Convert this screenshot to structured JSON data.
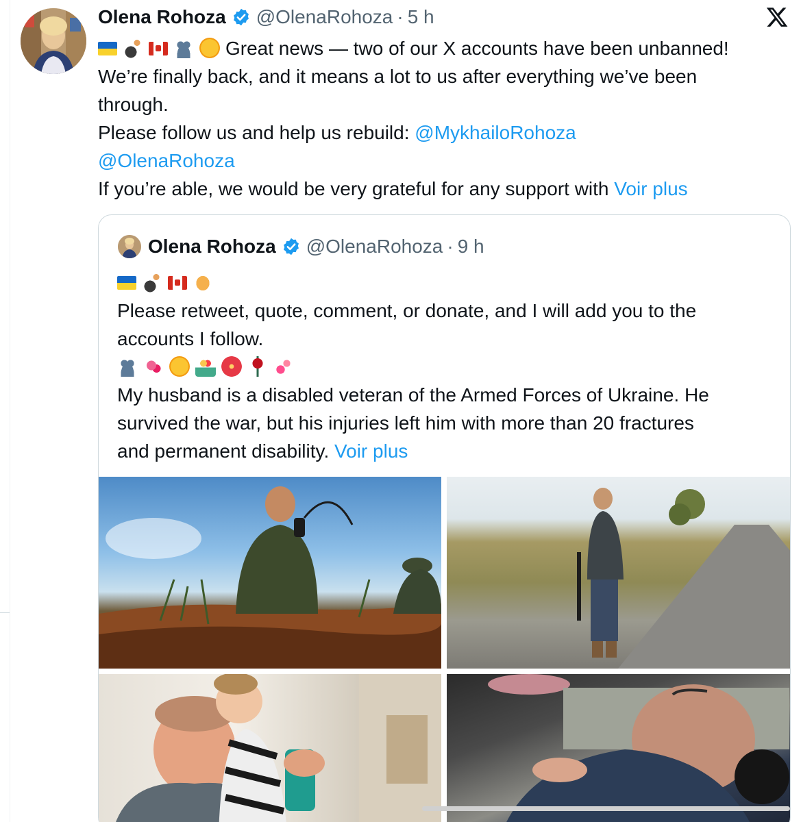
{
  "tweet": {
    "author_name": "Olena Rohoza",
    "handle": "@OlenaRohoza",
    "separator": "·",
    "time": "5 h",
    "line1_text": "Great news — two of our X accounts have been unbanned!",
    "line2_text": "We’re finally back, and it means a lot to us after everything we’ve been",
    "line3_text": "through.",
    "line4_text": "Please follow us and help us rebuild: ",
    "line4_mention": "@MykhailoRohoza",
    "line5_mention": "@OlenaRohoza",
    "line6_text": "If you’re able, we would be very grateful for any support with ",
    "line6_more": "Voir plus"
  },
  "quote": {
    "author_name": "Olena Rohoza",
    "handle": "@OlenaRohoza",
    "separator": "·",
    "time": "9 h",
    "line2_text": "Please retweet, quote, comment, or donate, and I will add you to the",
    "line3_text": "accounts I follow.",
    "line5_text": "My husband is a disabled veteran of the Armed Forces of Ukraine. He",
    "line6_text": "survived the war, but his injuries left him with more than 20 fractures",
    "line7_text": "and permanent disability. ",
    "line7_more": "Voir plus"
  },
  "icons": {
    "verified": "verified-badge-icon",
    "x_logo": "x-logo-icon",
    "emoji_sequence_main": [
      "flag-ukraine",
      "person-in-wheelchair",
      "flag-canada",
      "people-silhouettes",
      "smiling-face-with-hearts"
    ],
    "emoji_sequence_quote_1": [
      "flag-ukraine",
      "person-in-wheelchair",
      "flag-canada",
      "folded-hands"
    ],
    "emoji_sequence_quote_2": [
      "people-silhouettes",
      "heart-with-ribbon",
      "smiling-face-with-hearts",
      "bouquet",
      "hibiscus",
      "rose",
      "two-hearts"
    ]
  },
  "colors": {
    "text": "#0f1419",
    "secondary": "#536471",
    "link": "#1d9bf0",
    "verified": "#1d9bf0",
    "border": "#cfd9de"
  }
}
